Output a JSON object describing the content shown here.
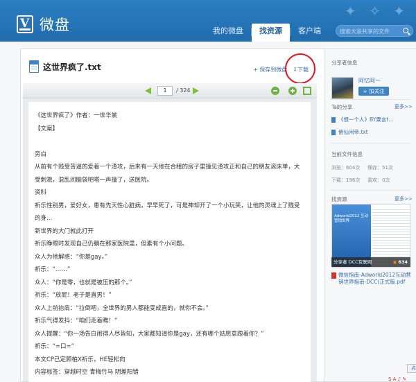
{
  "header": {
    "logo_text": "微盘",
    "nav": [
      "我的微盘",
      "找资源",
      "客户端"
    ],
    "active_nav": 1,
    "search_placeholder": "搜索大家共享的文件"
  },
  "file": {
    "title": "这世界疯了.txt",
    "save_label": "+ 保存到微盘",
    "download_label": "⇩下载"
  },
  "toolbar": {
    "current_page": "1",
    "total_pages": "/ 324"
  },
  "document": {
    "lines": [
      "《这世界疯了》作者：一世华裳",
      "【文案】",
      "",
      "旁白",
      "从前有个贱受苦逼的爱着一个渣攻，后来有一天他在合租的房子里撞见渣攻正和自己的朋友滚床单，大",
      "受刺激，混乱间脑袋吧嗒一声撞了，送医院。",
      "资料",
      "祈乐性别男，爱好女，患有先天性心脏病，早早死了，可是神却开了一个小玩笑，让他的灵魂上了贱受",
      "的身…",
      "新世界的大门就此打开",
      "祈乐睁眼时发现自己仍躺在那家医院里，但素有个小问题。",
      "众人为他解惑：“你是gay。”",
      "祈乐：“……”",
      "众人：“你是零，也就是被压的那个。”",
      "祈乐：“放屁！老子是直男！”",
      "众人上前抬肩：“拉倒吧，全世界的男人都能变成直的，就你不会。”",
      "祈乐气得发抖：“咱们走着瞧！”",
      "众人提醒：“你一场告白闹得人尽皆知，大家都知道你是gay，还有哪个姑愿意跟着你？”",
      "祈乐：“=口=”",
      "本文CP已定顾柏X祈乐，HE轻松向",
      "内容标签：穿越时空 青梅竹马 阴差阳错"
    ]
  },
  "sidebar": {
    "sharer_title": "分享者信息",
    "user_name": "阿忆阿一",
    "follow_label": "+ 加关注",
    "shares_title": "Ta的分享",
    "more_label": "更多>>",
    "shares": [
      "《惯一个人》BY粟言t…",
      "倦仙闲帝.txt"
    ],
    "stats_title": "当前文件信息",
    "stats": [
      {
        "label": "浏览：604次",
        "label2": "保存：51次"
      },
      {
        "label": "下载：196次",
        "label2": "喜欢：0次"
      }
    ],
    "resources_title": "找资源",
    "resources_more": "更多>>",
    "thumb_title": "Adworld2012 互动营销世界",
    "thumb_author": "分享者 DCC互联网",
    "thumb_count": "634",
    "pdf_name": "微信指南-Adworld2012互动营销世界指南-DCC(正式版.pdf",
    "bg_button": "点我设置"
  },
  "corner": "S A ♪ ✎"
}
